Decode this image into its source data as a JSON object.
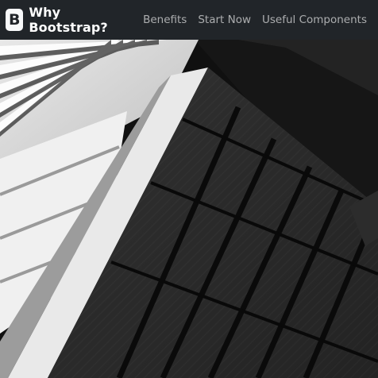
{
  "navbar": {
    "brand_logo": "B",
    "brand_text": "Why Bootstrap?",
    "links": [
      "Benefits",
      "Start Now",
      "Useful Components"
    ],
    "background": "#212529"
  },
  "hero": {
    "image_name": "architecture-photo"
  }
}
